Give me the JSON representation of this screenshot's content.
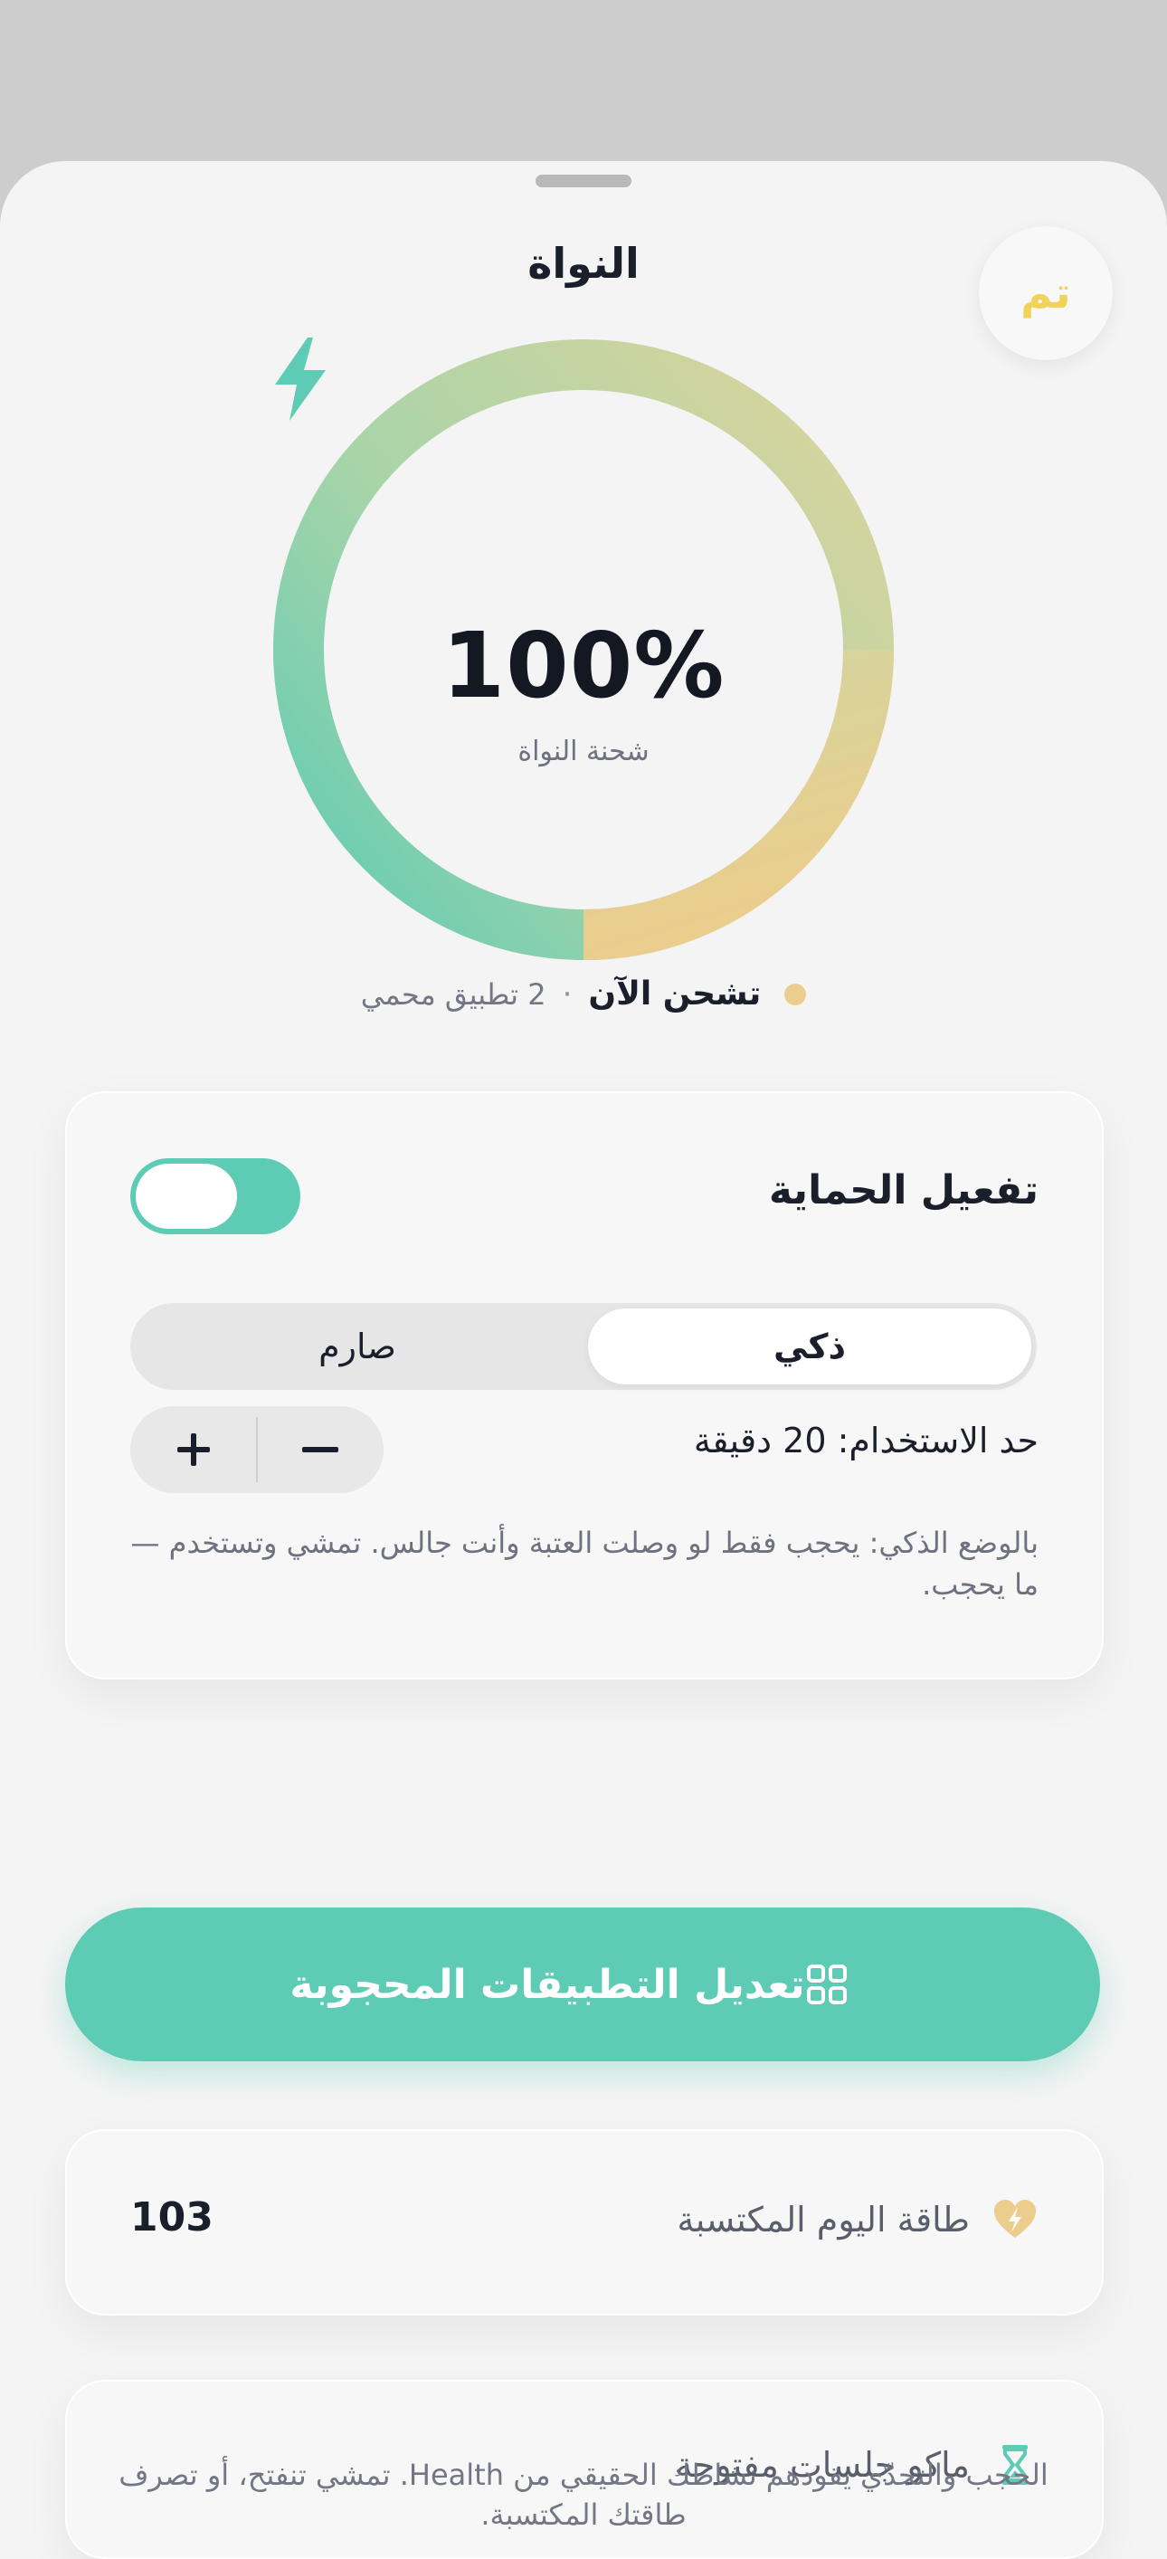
{
  "sheet": {
    "title": "النواة",
    "done_label": "تم"
  },
  "charge": {
    "percent_label": "100%",
    "percent_value": 100,
    "subtitle": "شحنة النواة",
    "bolt_icon": "bolt-icon",
    "ring_colors": [
      "#5ecbb4",
      "#93d2ab",
      "#c8d8a4",
      "#ebcd8d"
    ]
  },
  "status": {
    "main": "تشحن الآن",
    "separator": "·",
    "sub": "2 تطبيق محمي",
    "dot_color": "#ebcd8d"
  },
  "protection": {
    "title": "تفعيل الحماية",
    "enabled": true,
    "modes": {
      "smart": "ذكي",
      "strict": "صارم",
      "selected": "smart"
    },
    "usage_limit_label": "حد الاستخدام: 20 دقيقة",
    "usage_limit_minutes": 20,
    "plus_icon": "plus-icon",
    "minus_icon": "minus-icon",
    "description": "بالوضع الذكي: يحجب فقط لو وصلت العتبة وأنت جالس. تمشي وتستخدم — ما يحجب."
  },
  "edit_blocked": {
    "label": "تعديل التطبيقات المحجوبة",
    "icon": "grid-icon"
  },
  "energy": {
    "label": "طاقة اليوم المكتسبة",
    "value": "103",
    "icon": "heart-bolt-icon",
    "icon_color": "#ebcd8d"
  },
  "sessions": {
    "label": "ماكو جلسات مفتوحة",
    "icon": "hourglass-icon",
    "icon_color": "#5ecbb4"
  },
  "footer_note": "الحجب والتحدّي يقودهم نشاطك الحقيقي من Health. تمشي تنفتح، أو تصرف طاقتك المكتسبة.",
  "accent_color": "#5ecbb4"
}
